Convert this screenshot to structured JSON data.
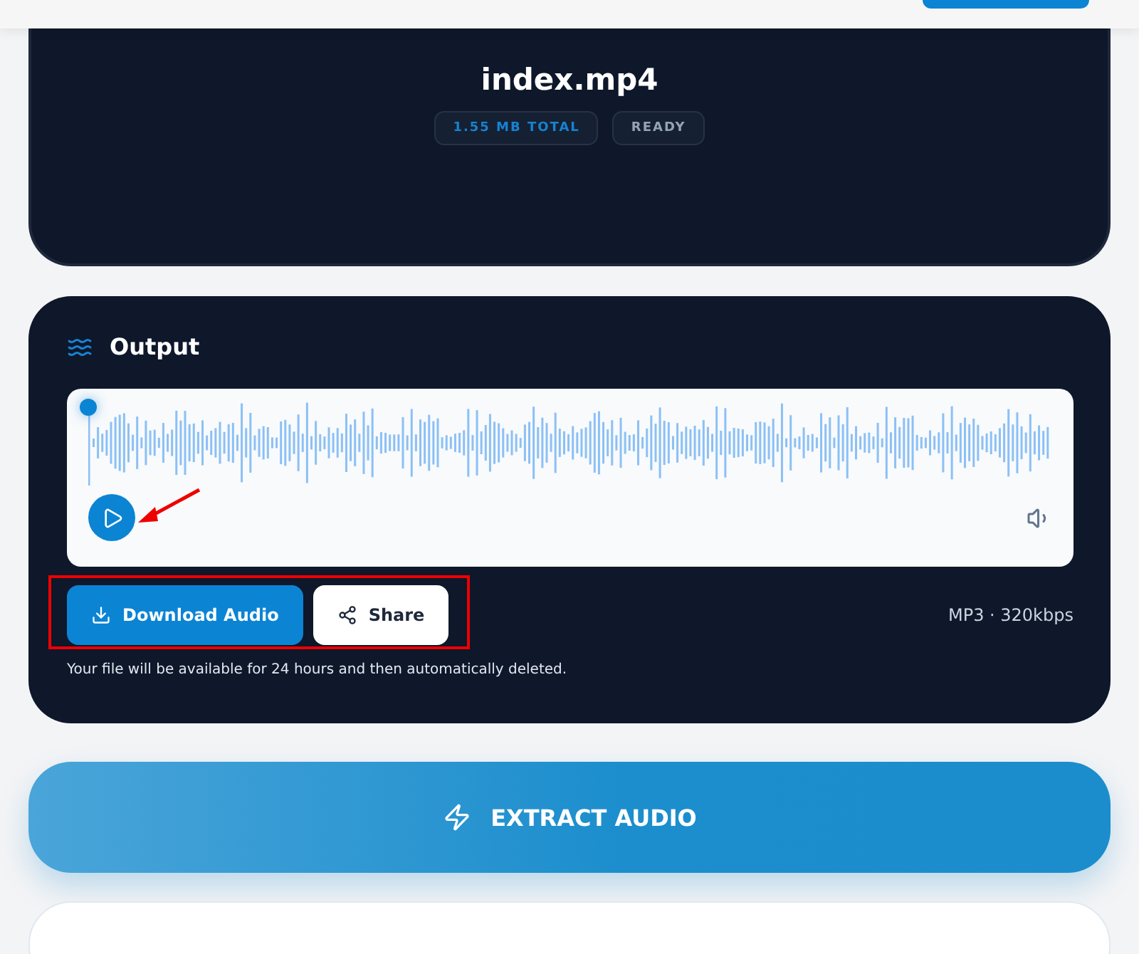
{
  "file": {
    "name": "index.mp4",
    "badges": [
      {
        "label": "1.55 MB TOTAL",
        "kind": "accent"
      },
      {
        "label": "READY",
        "kind": "muted"
      }
    ]
  },
  "output": {
    "title": "Output",
    "player": {
      "level": 0
    },
    "buttons": [
      {
        "label": "Download Audio",
        "kind": "primary"
      },
      {
        "label": "Share",
        "kind": "secondary"
      }
    ],
    "format": "MP3 · 320kbps",
    "note": "Your file will be available for 24 hours and then automatically deleted."
  },
  "extract_button": {
    "label": "EXTRACT AUDIO"
  }
}
